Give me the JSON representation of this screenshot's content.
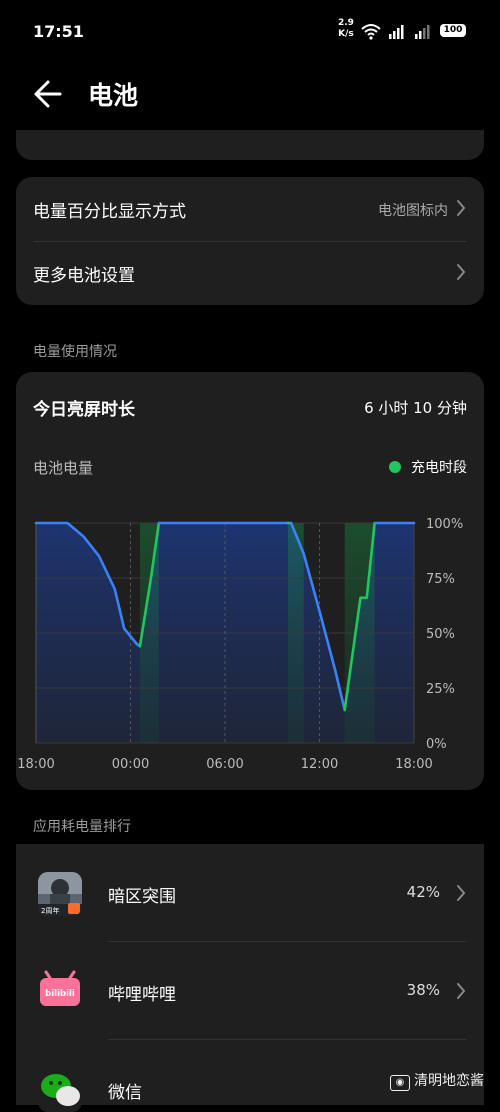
{
  "status_bar": {
    "time": "17:51",
    "net_speed_value": "2.9",
    "net_speed_unit": "K/s",
    "battery_level": "100"
  },
  "header": {
    "title": "电池"
  },
  "settings": {
    "battery_percent_label": "电量百分比显示方式",
    "battery_percent_value": "电池图标内",
    "more_settings_label": "更多电池设置"
  },
  "usage_section": {
    "label": "电量使用情况",
    "screen_on_label": "今日亮屏时长",
    "screen_on_value": "6 小时 10 分钟",
    "battery_title": "电池电量",
    "legend_label": "充电时段"
  },
  "chart_data": {
    "type": "line",
    "title": "电池电量",
    "x_ticks": [
      "18:00",
      "00:00",
      "06:00",
      "12:00",
      "18:00"
    ],
    "y_ticks": [
      "100%",
      "75%",
      "50%",
      "25%",
      "0%"
    ],
    "ylim": [
      0,
      100
    ],
    "xlim_hours": [
      18,
      42
    ],
    "grid": true,
    "series": [
      {
        "name": "电量",
        "color": "#3b82f6",
        "points": [
          [
            18.0,
            100
          ],
          [
            20.0,
            100
          ],
          [
            21.0,
            94
          ],
          [
            22.0,
            85
          ],
          [
            23.0,
            70
          ],
          [
            23.6,
            52
          ],
          [
            24.4,
            45
          ],
          [
            24.6,
            44
          ]
        ]
      },
      {
        "name": "充电时段",
        "color": "#22c55e",
        "points": [
          [
            24.6,
            44
          ],
          [
            25.3,
            75
          ],
          [
            25.8,
            100
          ]
        ]
      },
      {
        "name": "电量",
        "color": "#3b82f6",
        "points": [
          [
            25.8,
            100
          ],
          [
            34.0,
            100
          ]
        ]
      },
      {
        "name": "充电时段",
        "color": "#22c55e",
        "points": [
          [
            34.0,
            100
          ],
          [
            34.2,
            100
          ]
        ]
      },
      {
        "name": "电量",
        "color": "#3b82f6",
        "points": [
          [
            34.2,
            100
          ],
          [
            35.0,
            86
          ],
          [
            36.0,
            60
          ],
          [
            37.0,
            33
          ],
          [
            37.6,
            15
          ]
        ]
      },
      {
        "name": "充电时段",
        "color": "#22c55e",
        "points": [
          [
            37.6,
            15
          ],
          [
            38.6,
            66
          ],
          [
            39.0,
            66
          ],
          [
            39.5,
            100
          ]
        ]
      },
      {
        "name": "电量",
        "color": "#3b82f6",
        "points": [
          [
            39.5,
            100
          ],
          [
            42.0,
            100
          ]
        ]
      }
    ],
    "charging_ranges": [
      [
        24.6,
        25.8
      ],
      [
        34.0,
        35.0
      ],
      [
        37.6,
        39.5
      ]
    ],
    "vertical_marks_hours": [
      24,
      30,
      36
    ]
  },
  "ranking": {
    "label": "应用耗电量排行",
    "apps": [
      {
        "name": "暗区突围",
        "percent": "42%",
        "icon": "game-icon",
        "icon_text": "2周年"
      },
      {
        "name": "哔哩哔哩",
        "percent": "38%",
        "icon": "bilibili-icon",
        "icon_text": "bilibili"
      },
      {
        "name": "微信",
        "percent": "",
        "icon": "wechat-icon"
      }
    ]
  },
  "watermark": {
    "text": "清明地恋酱"
  }
}
